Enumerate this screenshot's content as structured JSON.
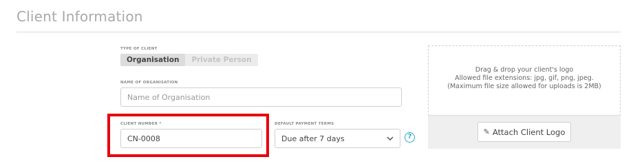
{
  "section": {
    "title": "Client Information"
  },
  "client_type": {
    "label": "TYPE OF CLIENT",
    "options": [
      "Organisation",
      "Private Person"
    ],
    "selected": "Organisation"
  },
  "organisation_name": {
    "label": "NAME OF ORGANISATION",
    "value": "",
    "placeholder": "Name of Organisation"
  },
  "client_number": {
    "label": "CLIENT NUMBER *",
    "value": "CN-0008"
  },
  "payment_terms": {
    "label": "DEFAULT PAYMENT TERMS",
    "selected": "Due after 7 days",
    "help_glyph": "?"
  },
  "logo_upload": {
    "line1": "Drag & drop your client's logo",
    "line2": "Allowed file extensions: jpg, gif, png, jpeg.",
    "line3": "(Maximum file size allowed for uploads is 2MB)",
    "button_label": "Attach Client Logo",
    "button_icon": "paperclip-icon"
  },
  "colors": {
    "highlight": "#e8000c",
    "help_accent": "#27a9c9"
  }
}
